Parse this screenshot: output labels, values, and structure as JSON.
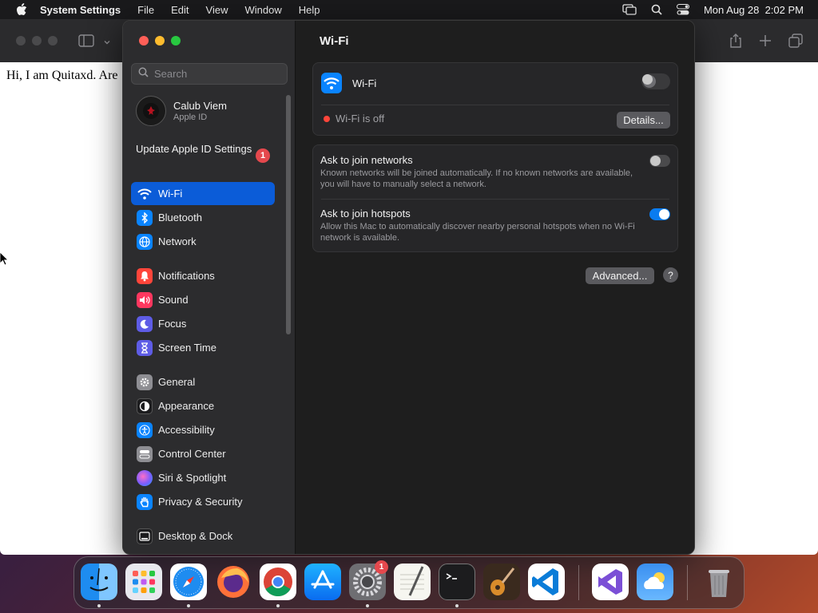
{
  "menubar": {
    "app_name": "System Settings",
    "menus": [
      "File",
      "Edit",
      "View",
      "Window",
      "Help"
    ],
    "datetime": "Mon Aug 28  2:02 PM"
  },
  "browser": {
    "page_text": "Hi, I am Quitaxd. Are"
  },
  "settings": {
    "search_placeholder": "Search",
    "account": {
      "name": "Calub Viem",
      "subtitle": "Apple ID"
    },
    "update": {
      "label": "Update Apple ID Settings",
      "badge": "1"
    },
    "sidebar": [
      {
        "label": "Wi-Fi",
        "icon": "wifi-icon",
        "color": "#0a84ff",
        "active": true
      },
      {
        "label": "Bluetooth",
        "icon": "bluetooth-icon",
        "color": "#0a84ff"
      },
      {
        "label": "Network",
        "icon": "globe-icon",
        "color": "#0a84ff"
      },
      {
        "label": "Notifications",
        "icon": "bell-icon",
        "color": "#ff453a"
      },
      {
        "label": "Sound",
        "icon": "speaker-icon",
        "color": "#ff375f"
      },
      {
        "label": "Focus",
        "icon": "moon-icon",
        "color": "#5e5ce6"
      },
      {
        "label": "Screen Time",
        "icon": "hourglass-icon",
        "color": "#5e5ce6"
      },
      {
        "label": "General",
        "icon": "gear-icon",
        "color": "#8e8e93"
      },
      {
        "label": "Appearance",
        "icon": "appearance-icon",
        "color": "#1c1c1e"
      },
      {
        "label": "Accessibility",
        "icon": "accessibility-icon",
        "color": "#0a84ff"
      },
      {
        "label": "Control Center",
        "icon": "control-center-icon",
        "color": "#8e8e93"
      },
      {
        "label": "Siri & Spotlight",
        "icon": "siri-icon",
        "color": "#bf5af2"
      },
      {
        "label": "Privacy & Security",
        "icon": "hand-icon",
        "color": "#0a84ff"
      },
      {
        "label": "Desktop & Dock",
        "icon": "dock-icon",
        "color": "#1c1c1e"
      }
    ]
  },
  "wifi_pane": {
    "title": "Wi-Fi",
    "wifi_label": "Wi-Fi",
    "wifi_enabled": false,
    "status_text": "Wi-Fi is off",
    "status_color": "#ff453a",
    "details_button": "Details...",
    "ask_networks": {
      "title": "Ask to join networks",
      "desc": "Known networks will be joined automatically. If no known networks are available, you will have to manually select a network.",
      "enabled": false
    },
    "ask_hotspots": {
      "title": "Ask to join hotspots",
      "desc": "Allow this Mac to automatically discover nearby personal hotspots when no Wi-Fi network is available.",
      "enabled": true
    },
    "advanced_button": "Advanced...",
    "help_button": "?"
  },
  "dock": {
    "apps": [
      {
        "name": "Finder",
        "icon": "finder-icon",
        "running": true
      },
      {
        "name": "Launchpad",
        "icon": "launchpad-icon",
        "running": false
      },
      {
        "name": "Safari",
        "icon": "safari-icon",
        "running": true
      },
      {
        "name": "Firefox",
        "icon": "firefox-icon",
        "running": false
      },
      {
        "name": "Chrome",
        "icon": "chrome-icon",
        "running": true
      },
      {
        "name": "App Store",
        "icon": "app-store-icon",
        "running": false
      },
      {
        "name": "System Settings",
        "icon": "system-settings-icon",
        "running": true,
        "badge": "1"
      },
      {
        "name": "TextEdit",
        "icon": "textedit-icon",
        "running": false
      },
      {
        "name": "Terminal",
        "icon": "terminal-icon",
        "running": true
      },
      {
        "name": "GarageBand",
        "icon": "garageband-icon",
        "running": false
      },
      {
        "name": "VS Code",
        "icon": "vscode-icon",
        "running": false
      },
      {
        "name": "Visual Studio",
        "icon": "visual-studio-icon",
        "running": false
      },
      {
        "name": "Weather",
        "icon": "weather-icon",
        "running": false
      },
      {
        "name": "Trash",
        "icon": "trash-icon",
        "running": false
      }
    ]
  }
}
